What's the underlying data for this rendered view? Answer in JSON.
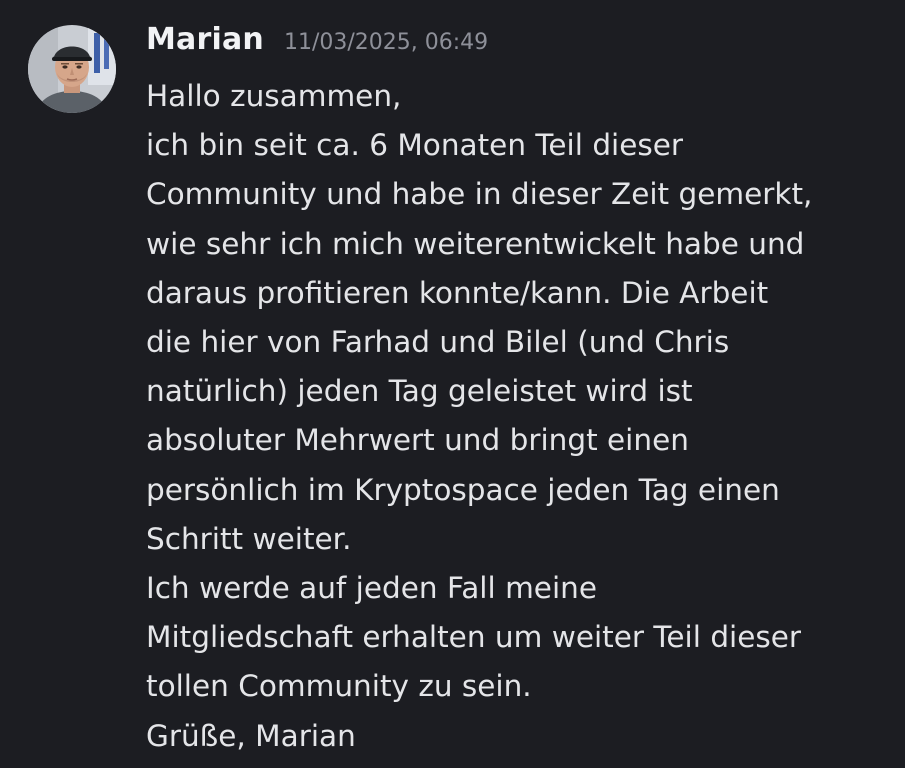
{
  "message": {
    "author": "Marian",
    "timestamp": "11/03/2025, 06:49",
    "avatar": "user-avatar-photo",
    "lines": [
      "Hallo zusammen,",
      "ich bin seit ca. 6 Monaten Teil dieser",
      "Community und habe in dieser Zeit gemerkt,",
      "wie sehr ich mich weiterentwickelt habe und",
      "daraus profitieren konnte/kann. Die Arbeit",
      "die hier von Farhad und Bilel (und Chris",
      "natürlich) jeden Tag geleistet wird ist",
      "absoluter Mehrwert und bringt einen",
      "persönlich im Kryptospace jeden Tag einen",
      "Schritt weiter.",
      "Ich werde auf jeden Fall meine",
      "Mitgliedschaft erhalten um weiter Teil dieser",
      "tollen Community zu sein.",
      "Grüße, Marian"
    ]
  },
  "colors": {
    "background": "#1c1d22",
    "username": "#f2f3f5",
    "timestamp": "#8e9099",
    "text": "#e4e5e8"
  }
}
